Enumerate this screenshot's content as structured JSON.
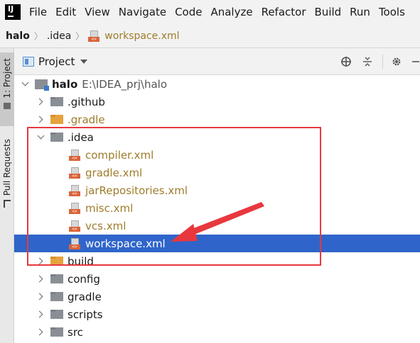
{
  "menubar": {
    "logo_text": "IJ",
    "items": [
      {
        "label": "File"
      },
      {
        "label": "Edit"
      },
      {
        "label": "View"
      },
      {
        "label": "Navigate"
      },
      {
        "label": "Code"
      },
      {
        "label": "Analyze"
      },
      {
        "label": "Refactor"
      },
      {
        "label": "Build"
      },
      {
        "label": "Run"
      },
      {
        "label": "Tools"
      }
    ]
  },
  "breadcrumb": {
    "root": "halo",
    "folder": ".idea",
    "file": "workspace.xml"
  },
  "left_strip": {
    "project_tab": "1: Project",
    "pull_requests_tab": "Pull Requests"
  },
  "panel": {
    "title": "Project"
  },
  "tree": {
    "root": {
      "name": "halo",
      "path": "E:\\IDEA_prj\\halo"
    },
    "items": [
      {
        "label": ".github",
        "kind": "folder",
        "color": "gray"
      },
      {
        "label": ".gradle",
        "kind": "folder",
        "color": "orange"
      },
      {
        "label": ".idea",
        "kind": "folder",
        "color": "gray"
      },
      {
        "label": "compiler.xml",
        "kind": "xml"
      },
      {
        "label": "gradle.xml",
        "kind": "xml"
      },
      {
        "label": "jarRepositories.xml",
        "kind": "xml"
      },
      {
        "label": "misc.xml",
        "kind": "xml"
      },
      {
        "label": "vcs.xml",
        "kind": "xml"
      },
      {
        "label": "workspace.xml",
        "kind": "xml",
        "selected": true
      },
      {
        "label": "build",
        "kind": "folder",
        "color": "orange"
      },
      {
        "label": "config",
        "kind": "folder",
        "color": "gray"
      },
      {
        "label": "gradle",
        "kind": "folder",
        "color": "gray"
      },
      {
        "label": "scripts",
        "kind": "folder",
        "color": "gray"
      },
      {
        "label": "src",
        "kind": "folder",
        "color": "gray"
      }
    ]
  },
  "colors": {
    "selection": "#2f65ca",
    "annotation_red": "#e8383d",
    "xml_badge": "#d9643a",
    "folder_orange": "#e6a23c",
    "folder_gray": "#8a8f96",
    "file_text": "#9e7c2a"
  }
}
